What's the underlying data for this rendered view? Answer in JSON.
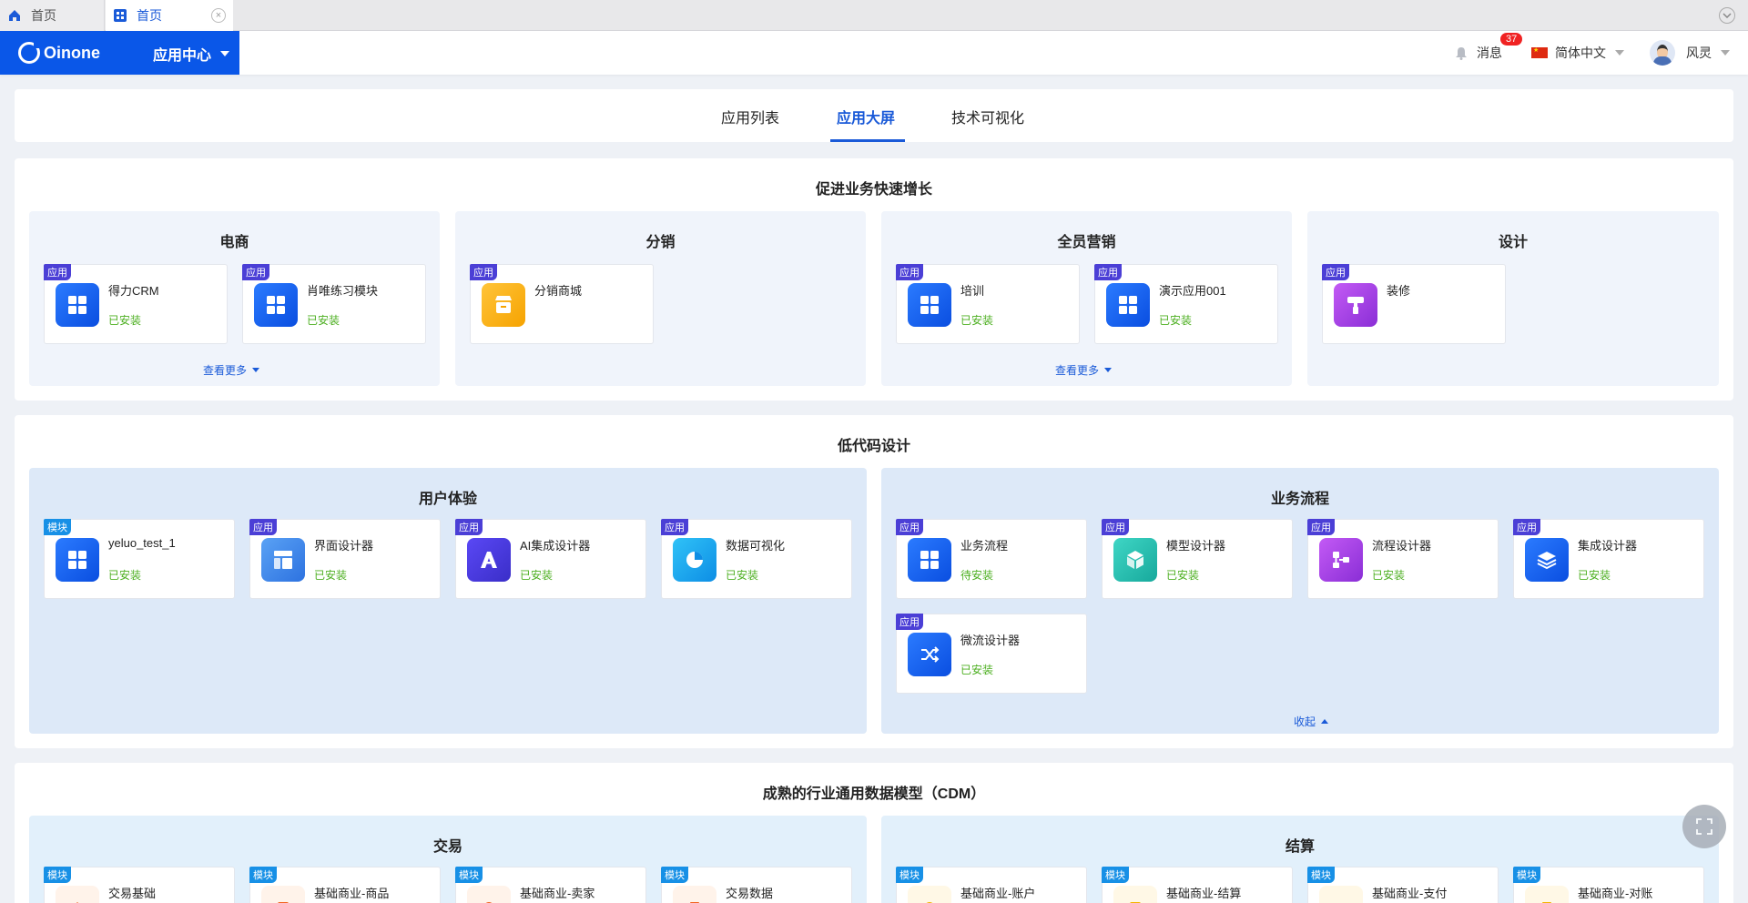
{
  "browser_tabs": [
    {
      "label": "首页",
      "icon": "home-icon"
    },
    {
      "label": "首页",
      "icon": "app-grid-icon",
      "active": true
    }
  ],
  "header": {
    "logo": "Oinone",
    "app_center": "应用中心",
    "messages_label": "消息",
    "messages_count": "37",
    "language": "简体中文",
    "user_name": "风灵"
  },
  "tabs": [
    {
      "label": "应用列表"
    },
    {
      "label": "应用大屏",
      "active": true
    },
    {
      "label": "技术可视化"
    }
  ],
  "sections": [
    {
      "title": "促进业务快速增长",
      "groups": [
        {
          "title": "电商",
          "more": "查看更多",
          "cards": [
            {
              "tag": "应用",
              "name": "得力CRM",
              "status": "已安装",
              "icon": "grid-icon"
            },
            {
              "tag": "应用",
              "name": "肖唯练习模块",
              "status": "已安装",
              "icon": "grid-icon"
            }
          ]
        },
        {
          "title": "分销",
          "cards": [
            {
              "tag": "应用",
              "name": "分销商城",
              "status": "",
              "icon": "store-icon"
            }
          ]
        },
        {
          "title": "全员营销",
          "more": "查看更多",
          "cards": [
            {
              "tag": "应用",
              "name": "培训",
              "status": "已安装",
              "icon": "grid-icon"
            },
            {
              "tag": "应用",
              "name": "演示应用001",
              "status": "已安装",
              "icon": "grid-icon"
            }
          ]
        },
        {
          "title": "设计",
          "cards": [
            {
              "tag": "应用",
              "name": "装修",
              "status": "",
              "icon": "paint-roller-icon"
            }
          ]
        }
      ]
    },
    {
      "title": "低代码设计",
      "groups": [
        {
          "title": "用户体验",
          "cards": [
            {
              "tag": "模块",
              "name": "yeluo_test_1",
              "status": "已安装",
              "icon": "grid-icon"
            },
            {
              "tag": "应用",
              "name": "界面设计器",
              "status": "已安装",
              "icon": "layout-icon"
            },
            {
              "tag": "应用",
              "name": "AI集成设计器",
              "status": "已安装",
              "icon": "ai-icon"
            },
            {
              "tag": "应用",
              "name": "数据可视化",
              "status": "已安装",
              "icon": "pie-chart-icon"
            }
          ]
        },
        {
          "title": "业务流程",
          "collapse": "收起",
          "cards": [
            {
              "tag": "应用",
              "name": "业务流程",
              "status": "待安装",
              "icon": "grid-icon"
            },
            {
              "tag": "应用",
              "name": "模型设计器",
              "status": "已安装",
              "icon": "cube-icon"
            },
            {
              "tag": "应用",
              "name": "流程设计器",
              "status": "已安装",
              "icon": "flow-icon"
            },
            {
              "tag": "应用",
              "name": "集成设计器",
              "status": "已安装",
              "icon": "layers-icon"
            },
            {
              "tag": "应用",
              "name": "微流设计器",
              "status": "已安装",
              "icon": "shuffle-icon"
            }
          ]
        }
      ]
    },
    {
      "title": "成熟的行业通用数据模型（CDM）",
      "groups": [
        {
          "title": "交易",
          "cards": [
            {
              "tag": "模块",
              "name": "交易基础",
              "icon": "trade-icon"
            },
            {
              "tag": "模块",
              "name": "基础商业-商品",
              "icon": "goods-icon"
            },
            {
              "tag": "模块",
              "name": "基础商业-卖家",
              "icon": "seller-icon"
            },
            {
              "tag": "模块",
              "name": "交易数据",
              "icon": "data-icon"
            }
          ]
        },
        {
          "title": "结算",
          "cards": [
            {
              "tag": "模块",
              "name": "基础商业-账户",
              "icon": "account-icon"
            },
            {
              "tag": "模块",
              "name": "基础商业-结算",
              "icon": "settle-icon"
            },
            {
              "tag": "模块",
              "name": "基础商业-支付",
              "icon": "pay-icon"
            },
            {
              "tag": "模块",
              "name": "基础商业-对账",
              "icon": "reconcile-icon"
            }
          ]
        }
      ]
    }
  ],
  "colors": {
    "brand": "#0a57e8",
    "installed": "#4caf20",
    "link": "#1a5ad8"
  }
}
